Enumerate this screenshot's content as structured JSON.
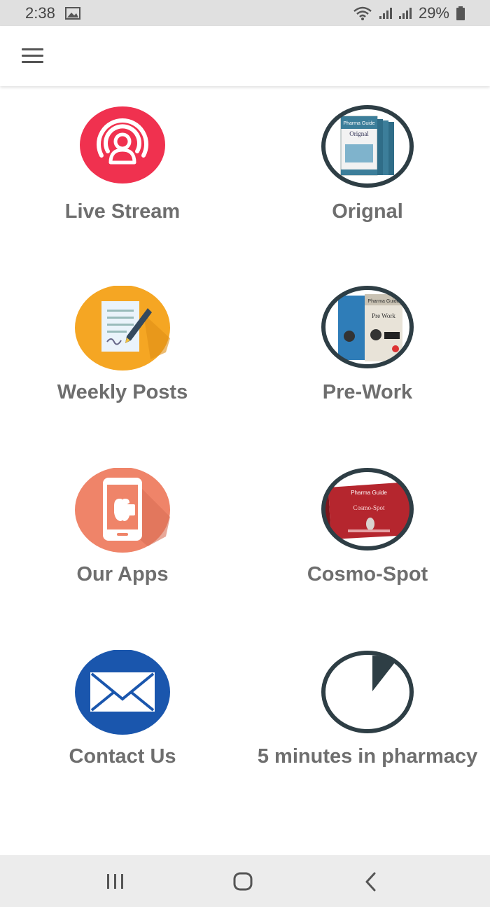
{
  "status_bar": {
    "time": "2:38",
    "battery": "29%"
  },
  "tiles": [
    {
      "label": "Live Stream"
    },
    {
      "label": "Orignal"
    },
    {
      "label": "Weekly Posts"
    },
    {
      "label": "Pre-Work"
    },
    {
      "label": "Our Apps"
    },
    {
      "label": "Cosmo-Spot"
    },
    {
      "label": "Contact Us"
    },
    {
      "label": "5 minutes in pharmacy"
    }
  ],
  "book_covers": {
    "orignal": {
      "brand": "Pharma Guide",
      "title": "Orignal"
    },
    "pre_work": {
      "brand": "Pharma Guide",
      "title": "Pre Work"
    },
    "cosmo_spot": {
      "brand": "Pharma Guide",
      "title": "Cosmo-Spot"
    }
  },
  "colors": {
    "live_stream": "#f0314f",
    "weekly_posts": "#f5a623",
    "our_apps": "#ef8469",
    "contact_us": "#1a56ad",
    "ring": "#2e3e45",
    "label": "#6e6e6e"
  }
}
